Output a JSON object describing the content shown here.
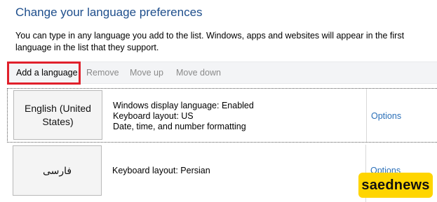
{
  "header": {
    "title": "Change your language preferences",
    "description": "You can type in any language you add to the list. Windows, apps and websites will appear in the first language in the list that they support."
  },
  "toolbar": {
    "add_label": "Add a language",
    "remove_label": "Remove",
    "move_up_label": "Move up",
    "move_down_label": "Move down"
  },
  "languages": [
    {
      "name": "English (United States)",
      "details": [
        "Windows display language: Enabled",
        "Keyboard layout: US",
        "Date, time, and number formatting"
      ],
      "options_label": "Options"
    },
    {
      "name": "فارسی",
      "details": [
        "Keyboard layout: Persian"
      ],
      "options_label": "Options"
    }
  ],
  "watermark": {
    "text": "saednews",
    "color": "#ffd500"
  },
  "colors": {
    "title": "#1e4e8c",
    "link": "#2a6fb8",
    "highlight_border": "#e0202b",
    "disabled_text": "#8a8a8a"
  }
}
